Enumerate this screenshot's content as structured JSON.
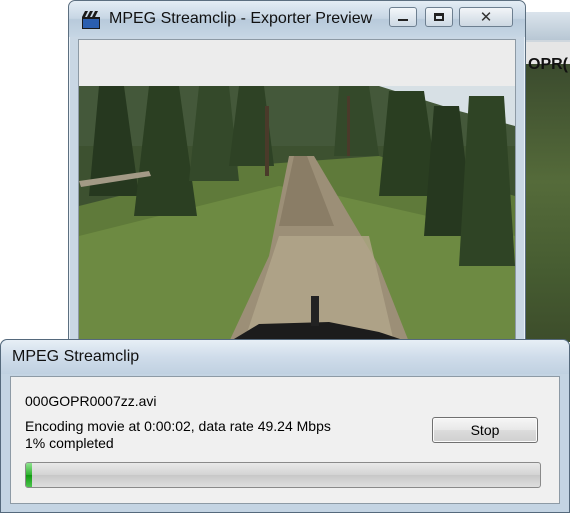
{
  "background_window": {
    "label": "OPR("
  },
  "preview_window": {
    "title": "MPEG Streamclip - Exporter Preview",
    "icon": "clapperboard-icon",
    "controls": {
      "minimize_icon": "minimize-icon",
      "maximize_icon": "maximize-icon",
      "close_icon": "close-icon",
      "close_glyph": "✕"
    }
  },
  "progress_dialog": {
    "title": "MPEG Streamclip",
    "filename": "000GOPR0007zz.avi",
    "status": "Encoding movie at 0:00:02, data rate 49.24 Mbps",
    "percent_text": "1% completed",
    "stop_label": "Stop",
    "progress_fraction": 0.01
  },
  "colors": {
    "accent": "#1fa71f"
  }
}
